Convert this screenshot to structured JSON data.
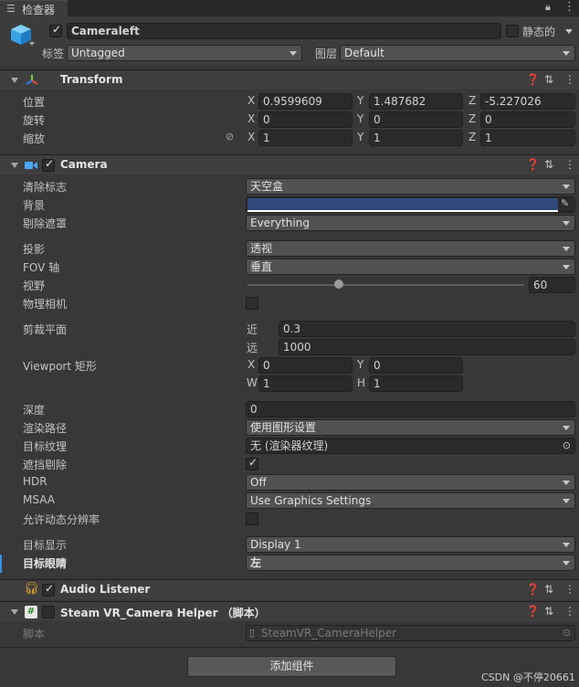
{
  "tab": {
    "title": "检查器"
  },
  "object": {
    "name": "Cameraleft",
    "static_label": "静态的",
    "tag_label": "标签",
    "tag_value": "Untagged",
    "layer_label": "图层",
    "layer_value": "Default"
  },
  "transform": {
    "title": "Transform",
    "position_label": "位置",
    "rotation_label": "旋转",
    "scale_label": "缩放",
    "axis_x": "X",
    "axis_y": "Y",
    "axis_z": "Z",
    "position": {
      "x": "0.9599609",
      "y": "1.487682",
      "z": "-5.227026"
    },
    "rotation": {
      "x": "0",
      "y": "0",
      "z": "0"
    },
    "scale": {
      "x": "1",
      "y": "1",
      "z": "1"
    }
  },
  "camera": {
    "title": "Camera",
    "clear_flags_label": "清除标志",
    "clear_flags_value": "天空盒",
    "background_label": "背景",
    "background_color": "#2e4a7a",
    "culling_mask_label": "剔除遮罩",
    "culling_mask_value": "Everything",
    "projection_label": "投影",
    "projection_value": "透视",
    "fov_axis_label": "FOV 轴",
    "fov_axis_value": "垂直",
    "fov_label": "视野",
    "fov_value": "60",
    "fov_slider_fraction": 0.33,
    "physical_label": "物理相机",
    "clipping_label": "剪裁平面",
    "near_label": "近",
    "near_value": "0.3",
    "far_label": "远",
    "far_value": "1000",
    "viewport_label": "Viewport 矩形",
    "vp_x_label": "X",
    "vp_y_label": "Y",
    "vp_w_label": "W",
    "vp_h_label": "H",
    "vp_x": "0",
    "vp_y": "0",
    "vp_w": "1",
    "vp_h": "1",
    "depth_label": "深度",
    "depth_value": "0",
    "rendering_path_label": "渲染路径",
    "rendering_path_value": "使用图形设置",
    "target_texture_label": "目标纹理",
    "target_texture_value": "无 (渲染器纹理)",
    "occlusion_label": "遮挡剔除",
    "hdr_label": "HDR",
    "hdr_value": "Off",
    "msaa_label": "MSAA",
    "msaa_value": "Use Graphics Settings",
    "dynamic_res_label": "允许动态分辨率",
    "target_display_label": "目标显示",
    "target_display_value": "Display 1",
    "target_eye_label": "目标眼睛",
    "target_eye_value": "左"
  },
  "audio": {
    "title": "Audio Listener"
  },
  "steam": {
    "title": "Steam VR_Camera Helper （脚本）",
    "script_label": "脚本",
    "script_value": "SteamVR_CameraHelper"
  },
  "add_component_label": "添加组件",
  "watermark": "CSDN @不停20661"
}
